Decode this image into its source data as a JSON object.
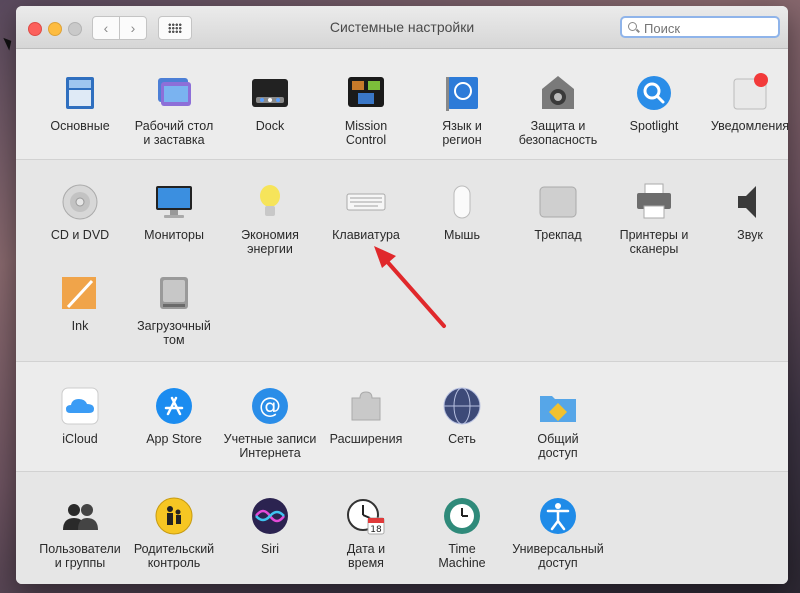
{
  "window": {
    "title": "Системные настройки"
  },
  "search": {
    "placeholder": "Поиск"
  },
  "sections": [
    [
      {
        "name": "osnovnye",
        "label": "Основные",
        "icon": "general-icon"
      },
      {
        "name": "desktop",
        "label": "Рабочий стол\nи заставка",
        "icon": "desktop-screensaver-icon"
      },
      {
        "name": "dock",
        "label": "Dock",
        "icon": "dock-icon"
      },
      {
        "name": "mission-control",
        "label": "Mission\nControl",
        "icon": "mission-control-icon"
      },
      {
        "name": "language",
        "label": "Язык и\nрегион",
        "icon": "language-region-icon"
      },
      {
        "name": "security",
        "label": "Защита и\nбезопасность",
        "icon": "security-icon"
      },
      {
        "name": "spotlight",
        "label": "Spotlight",
        "icon": "spotlight-icon"
      },
      {
        "name": "notifications",
        "label": "Уведомления",
        "icon": "notifications-icon"
      }
    ],
    [
      {
        "name": "cd-dvd",
        "label": "CD и DVD",
        "icon": "cd-dvd-icon"
      },
      {
        "name": "displays",
        "label": "Мониторы",
        "icon": "displays-icon"
      },
      {
        "name": "energy",
        "label": "Экономия\nэнергии",
        "icon": "energy-saver-icon"
      },
      {
        "name": "keyboard",
        "label": "Клавиатура",
        "icon": "keyboard-icon"
      },
      {
        "name": "mouse",
        "label": "Мышь",
        "icon": "mouse-icon"
      },
      {
        "name": "trackpad",
        "label": "Трекпад",
        "icon": "trackpad-icon"
      },
      {
        "name": "printers",
        "label": "Принтеры и\nсканеры",
        "icon": "printer-icon"
      },
      {
        "name": "sound",
        "label": "Звук",
        "icon": "sound-icon"
      },
      {
        "name": "ink",
        "label": "Ink",
        "icon": "ink-icon"
      },
      {
        "name": "startup-disk",
        "label": "Загрузочный\nтом",
        "icon": "startup-disk-icon"
      }
    ],
    [
      {
        "name": "icloud",
        "label": "iCloud",
        "icon": "icloud-icon"
      },
      {
        "name": "app-store",
        "label": "App Store",
        "icon": "app-store-icon"
      },
      {
        "name": "internet-accounts",
        "label": "Учетные записи\nИнтернета",
        "icon": "internet-accounts-icon"
      },
      {
        "name": "extensions",
        "label": "Расширения",
        "icon": "extensions-icon"
      },
      {
        "name": "network",
        "label": "Сеть",
        "icon": "network-icon"
      },
      {
        "name": "sharing",
        "label": "Общий\nдоступ",
        "icon": "sharing-icon"
      }
    ],
    [
      {
        "name": "users",
        "label": "Пользователи\nи группы",
        "icon": "users-groups-icon"
      },
      {
        "name": "parental",
        "label": "Родительский\nконтроль",
        "icon": "parental-controls-icon"
      },
      {
        "name": "siri",
        "label": "Siri",
        "icon": "siri-icon"
      },
      {
        "name": "date-time",
        "label": "Дата и\nвремя",
        "icon": "date-time-icon"
      },
      {
        "name": "time-machine",
        "label": "Time\nMachine",
        "icon": "time-machine-icon"
      },
      {
        "name": "accessibility",
        "label": "Универсальный\nдоступ",
        "icon": "accessibility-icon"
      }
    ]
  ],
  "calendar_day": "18",
  "colors": {
    "arrow": "#e0282b",
    "accent": "#1f7ae0"
  }
}
